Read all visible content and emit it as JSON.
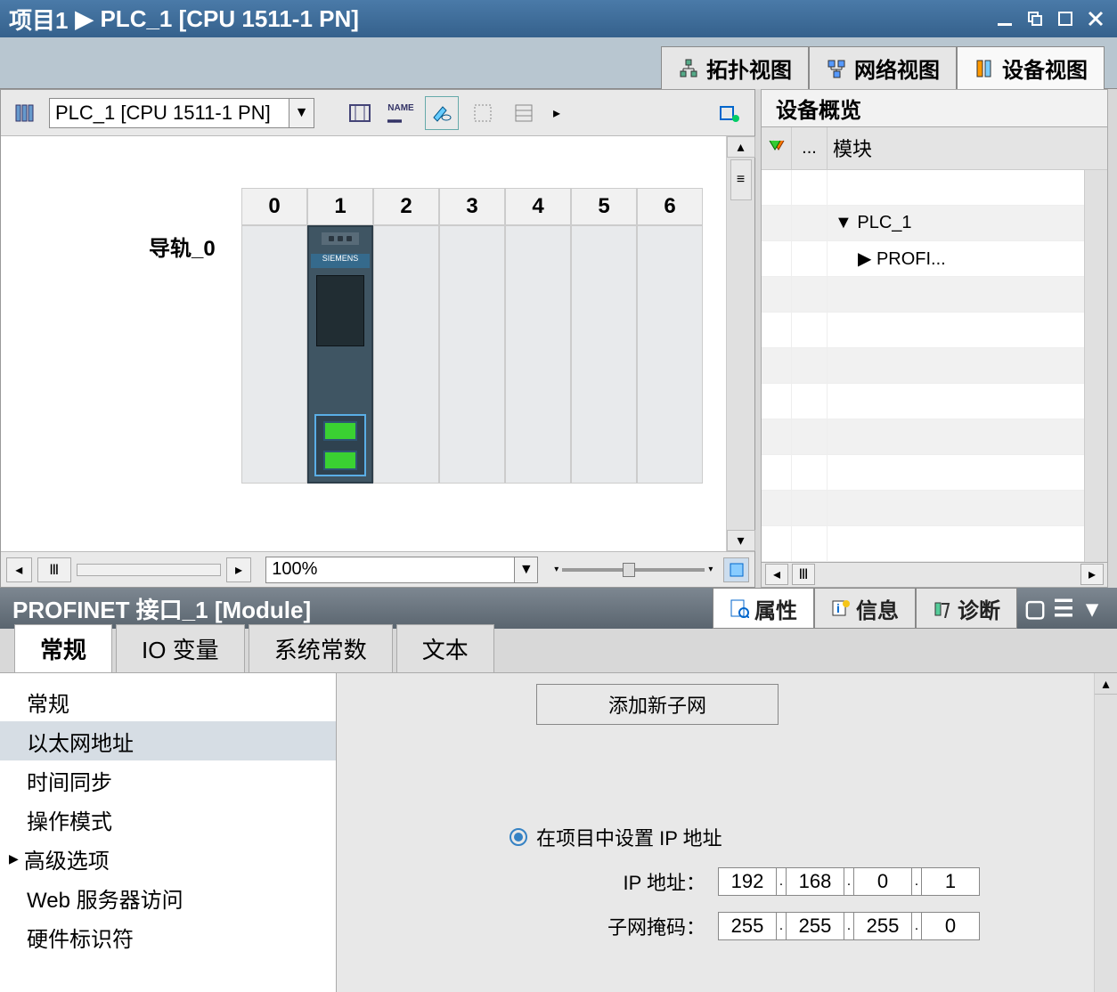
{
  "title": {
    "project": "项目1",
    "sep": "▶",
    "device": "PLC_1 [CPU 1511-1 PN]"
  },
  "viewtabs": {
    "topology": "拓扑视图",
    "network": "网络视图",
    "device": "设备视图"
  },
  "tbar": {
    "device": "PLC_1 [CPU 1511-1 PN]",
    "zoom": "100%"
  },
  "rail": {
    "name": "导轨_0",
    "slots": [
      "0",
      "1",
      "2",
      "3",
      "4",
      "5",
      "6"
    ]
  },
  "overview": {
    "title": "设备概览",
    "col_dots": "...",
    "col_module": "模块",
    "rows": [
      {
        "indent": 1,
        "label": "▼  PLC_1"
      },
      {
        "indent": 2,
        "label": "▶  PROFI..."
      }
    ]
  },
  "inspector": {
    "title": "PROFINET 接口_1 [Module]",
    "pods": {
      "props": "属性",
      "info": "信息",
      "diag": "诊断"
    },
    "tabs": {
      "general": "常规",
      "iovars": "IO 变量",
      "sysconst": "系统常数",
      "text": "文本"
    },
    "nav": {
      "general": "常规",
      "ethaddr": "以太网地址",
      "timesync": "时间同步",
      "opmode": "操作模式",
      "advopt": "高级选项",
      "webserver": "Web 服务器访问",
      "hwid": "硬件标识符"
    },
    "addsubnet_btn": "添加新子网",
    "radio_setip": "在项目中设置 IP 地址",
    "ip_label": "IP 地址：",
    "ip": [
      "192",
      "168",
      "0",
      "1"
    ],
    "mask_label": "子网掩码：",
    "mask": [
      "255",
      "255",
      "255",
      "0"
    ]
  }
}
